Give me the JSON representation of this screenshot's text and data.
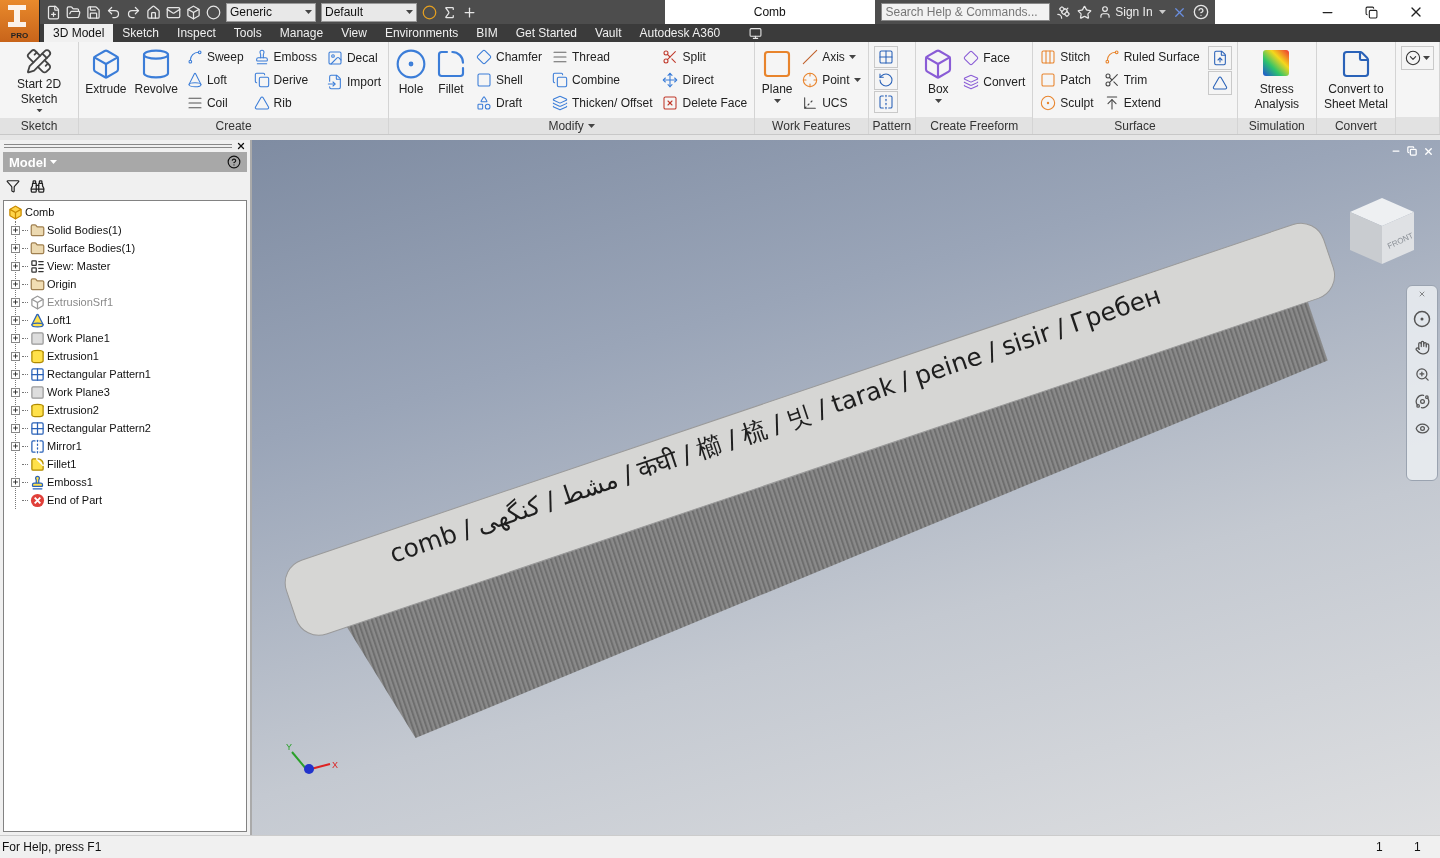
{
  "app_badge": "PRO",
  "quick_access": {
    "material": "Generic",
    "appearance": "Default"
  },
  "window": {
    "title": "Comb"
  },
  "help_bar": {
    "search_placeholder": "Search Help & Commands...",
    "sign_in": "Sign In"
  },
  "tabs": [
    {
      "label": "3D Model",
      "selected": true
    },
    {
      "label": "Sketch",
      "selected": false
    },
    {
      "label": "Inspect",
      "selected": false
    },
    {
      "label": "Tools",
      "selected": false
    },
    {
      "label": "Manage",
      "selected": false
    },
    {
      "label": "View",
      "selected": false
    },
    {
      "label": "Environments",
      "selected": false
    },
    {
      "label": "BIM",
      "selected": false
    },
    {
      "label": "Get Started",
      "selected": false
    },
    {
      "label": "Vault",
      "selected": false
    },
    {
      "label": "Autodesk A360",
      "selected": false
    }
  ],
  "ribbon": [
    {
      "title": "Sketch",
      "groups": [
        {
          "kind": "large",
          "tools": [
            {
              "label": "Start 2D Sketch",
              "has_menu": true
            }
          ]
        }
      ]
    },
    {
      "title": "Create",
      "groups": [
        {
          "kind": "large",
          "tools": [
            {
              "label": "Extrude",
              "has_menu": false
            }
          ]
        },
        {
          "kind": "large",
          "tools": [
            {
              "label": "Revolve",
              "has_menu": false
            }
          ]
        },
        {
          "kind": "column",
          "tools": [
            {
              "label": "Sweep",
              "has_menu": false
            },
            {
              "label": "Loft",
              "has_menu": false
            },
            {
              "label": "Coil",
              "has_menu": false
            }
          ]
        },
        {
          "kind": "column",
          "tools": [
            {
              "label": "Emboss",
              "has_menu": false
            },
            {
              "label": "Derive",
              "has_menu": false
            },
            {
              "label": "Rib",
              "has_menu": false
            }
          ]
        },
        {
          "kind": "column",
          "tools": [
            {
              "label": "Decal",
              "has_menu": false
            },
            {
              "label": "Import",
              "has_menu": false
            }
          ]
        }
      ]
    },
    {
      "title": "Modify",
      "has_menu": true,
      "groups": [
        {
          "kind": "large",
          "tools": [
            {
              "label": "Hole",
              "has_menu": false
            }
          ]
        },
        {
          "kind": "large",
          "tools": [
            {
              "label": "Fillet",
              "has_menu": false
            }
          ]
        },
        {
          "kind": "column",
          "tools": [
            {
              "label": "Chamfer",
              "has_menu": false
            },
            {
              "label": "Shell",
              "has_menu": false
            },
            {
              "label": "Draft",
              "has_menu": false
            }
          ]
        },
        {
          "kind": "column",
          "tools": [
            {
              "label": "Thread",
              "has_menu": false
            },
            {
              "label": "Combine",
              "has_menu": false
            },
            {
              "label": "Thicken/ Offset",
              "has_menu": false
            }
          ]
        },
        {
          "kind": "column",
          "tools": [
            {
              "label": "Split",
              "has_menu": false
            },
            {
              "label": "Direct",
              "has_menu": false
            },
            {
              "label": "Delete Face",
              "has_menu": false
            }
          ]
        }
      ]
    },
    {
      "title": "Work Features",
      "groups": [
        {
          "kind": "large",
          "tools": [
            {
              "label": "Plane",
              "has_menu": true
            }
          ]
        },
        {
          "kind": "column",
          "tools": [
            {
              "label": "Axis",
              "has_menu": true
            },
            {
              "label": "Point",
              "has_menu": true
            },
            {
              "label": "UCS",
              "has_menu": false
            }
          ]
        }
      ]
    },
    {
      "title": "Pattern",
      "groups": [
        {
          "kind": "column",
          "tools": [
            {
              "has_menu": false
            },
            {
              "has_menu": false
            },
            {
              "has_menu": false
            }
          ]
        }
      ]
    },
    {
      "title": "Create Freeform",
      "groups": [
        {
          "kind": "large",
          "tools": [
            {
              "label": "Box",
              "has_menu": true
            }
          ]
        },
        {
          "kind": "column",
          "tools": [
            {
              "label": "Face",
              "has_menu": false
            },
            {
              "label": "Convert",
              "has_menu": false
            }
          ]
        }
      ]
    },
    {
      "title": "Surface",
      "groups": [
        {
          "kind": "column",
          "tools": [
            {
              "label": "Stitch",
              "has_menu": false
            },
            {
              "label": "Patch",
              "has_menu": false
            },
            {
              "label": "Sculpt",
              "has_menu": false
            }
          ]
        },
        {
          "kind": "column",
          "tools": [
            {
              "label": "Ruled Surface",
              "has_menu": false
            },
            {
              "label": "Trim",
              "has_menu": false
            },
            {
              "label": "Extend",
              "has_menu": false
            }
          ]
        },
        {
          "kind": "column",
          "tools": [
            {
              "has_menu": false
            },
            {
              "has_menu": false
            }
          ]
        }
      ]
    },
    {
      "title": "Simulation",
      "groups": [
        {
          "kind": "large",
          "tools": [
            {
              "label": "Stress Analysis",
              "has_menu": false
            }
          ]
        }
      ]
    },
    {
      "title": "Convert",
      "groups": [
        {
          "kind": "large",
          "tools": [
            {
              "label": "Convert to Sheet Metal",
              "has_menu": false
            }
          ]
        }
      ]
    },
    {
      "groups": [
        {
          "kind": "column",
          "tools": [
            {
              "has_menu": true
            }
          ]
        }
      ]
    }
  ],
  "browser": {
    "title": "Model",
    "tree": {
      "label": "Comb",
      "kind": "part",
      "children": [
        {
          "label": "Solid Bodies(1)",
          "kind": "solid-bodies",
          "collapsed": true,
          "dimmed": false
        },
        {
          "label": "Surface Bodies(1)",
          "kind": "surface-bodies",
          "collapsed": true,
          "dimmed": false
        },
        {
          "label": "View: Master",
          "kind": "view",
          "collapsed": true,
          "dimmed": false
        },
        {
          "label": "Origin",
          "kind": "folder",
          "collapsed": true,
          "dimmed": false
        },
        {
          "label": "ExtrusionSrf1",
          "kind": "surface",
          "collapsed": true,
          "dimmed": true
        },
        {
          "label": "Loft1",
          "kind": "loft",
          "collapsed": true,
          "dimmed": false
        },
        {
          "label": "Work Plane1",
          "kind": "plane",
          "collapsed": true,
          "dimmed": false
        },
        {
          "label": "Extrusion1",
          "kind": "extrusion",
          "collapsed": true,
          "dimmed": false
        },
        {
          "label": "Rectangular Pattern1",
          "kind": "pattern",
          "collapsed": true,
          "dimmed": false
        },
        {
          "label": "Work Plane3",
          "kind": "plane",
          "collapsed": true,
          "dimmed": false
        },
        {
          "label": "Extrusion2",
          "kind": "extrusion",
          "collapsed": true,
          "dimmed": false
        },
        {
          "label": "Rectangular Pattern2",
          "kind": "pattern",
          "collapsed": true,
          "dimmed": false
        },
        {
          "label": "Mirror1",
          "kind": "mirror",
          "collapsed": true,
          "dimmed": false
        },
        {
          "label": "Fillet1",
          "kind": "fillet",
          "collapsed": false,
          "dimmed": false
        },
        {
          "label": "Emboss1",
          "kind": "emboss",
          "collapsed": true,
          "dimmed": false
        },
        {
          "label": "End of Part",
          "kind": "end",
          "collapsed": false,
          "dimmed": false
        }
      ]
    }
  },
  "viewport": {
    "embossed_words": [
      "comb",
      "کنگھی",
      "مشط",
      "कंघी",
      "櫛",
      "梳",
      "빗",
      "tarak",
      "peine",
      "sisir",
      "Гребен"
    ],
    "separator": "/",
    "view_cube_face": "FRONT",
    "axis_labels": {
      "x": "X",
      "y": "Y"
    }
  },
  "status_bar": {
    "help": "For Help, press F1",
    "value_1": "1",
    "value_2": "1"
  }
}
